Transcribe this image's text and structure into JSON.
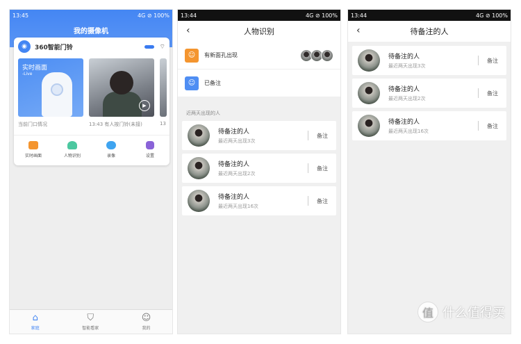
{
  "screen1": {
    "status": {
      "time": "13:45",
      "right": "4G ⊘ 100%"
    },
    "title": "我的摄像机",
    "device": {
      "name": "360智能门铃"
    },
    "tiles": [
      {
        "label": "实时画面",
        "sub": "-Live",
        "caption": "当前门口情况"
      },
      {
        "caption": "13:43 有人按门铃(未接)"
      },
      {
        "caption": "13"
      }
    ],
    "actions": [
      {
        "label": "实时画面",
        "icon": "video-icon",
        "color": "#f4952f"
      },
      {
        "label": "人物识别",
        "icon": "person-icon",
        "color": "#4cc8a0"
      },
      {
        "label": "录像",
        "icon": "cloud-icon",
        "color": "#3fa4f0"
      },
      {
        "label": "设置",
        "icon": "gear-icon",
        "color": "#8a63d8"
      }
    ],
    "nav": [
      {
        "label": "家庭",
        "icon": "home-icon"
      },
      {
        "label": "智能看家",
        "icon": "shield-icon"
      },
      {
        "label": "我的",
        "icon": "user-icon"
      }
    ]
  },
  "screen2": {
    "status": {
      "time": "13:44",
      "right": "4G ⊘ 100%"
    },
    "title": "人物识别",
    "menu": [
      {
        "label": "有新面孔出现",
        "color": "#f4952f"
      },
      {
        "label": "已备注",
        "color": "#4f8ef3"
      }
    ],
    "section": "近两天出现的人",
    "people": [
      {
        "name": "待备注的人",
        "desc": "最近两天出现3次",
        "action": "备注"
      },
      {
        "name": "待备注的人",
        "desc": "最近两天出现2次",
        "action": "备注"
      },
      {
        "name": "待备注的人",
        "desc": "最近两天出现16次",
        "action": "备注"
      }
    ]
  },
  "screen3": {
    "status": {
      "time": "13:44",
      "right": "4G ⊘ 100%"
    },
    "title": "待备注的人",
    "people": [
      {
        "name": "待备注的人",
        "desc": "最近两天出现3次",
        "action": "备注"
      },
      {
        "name": "待备注的人",
        "desc": "最近两天出现2次",
        "action": "备注"
      },
      {
        "name": "待备注的人",
        "desc": "最近两天出现16次",
        "action": "备注"
      }
    ]
  },
  "watermark": {
    "text": "什么值得买",
    "badge": "值"
  }
}
